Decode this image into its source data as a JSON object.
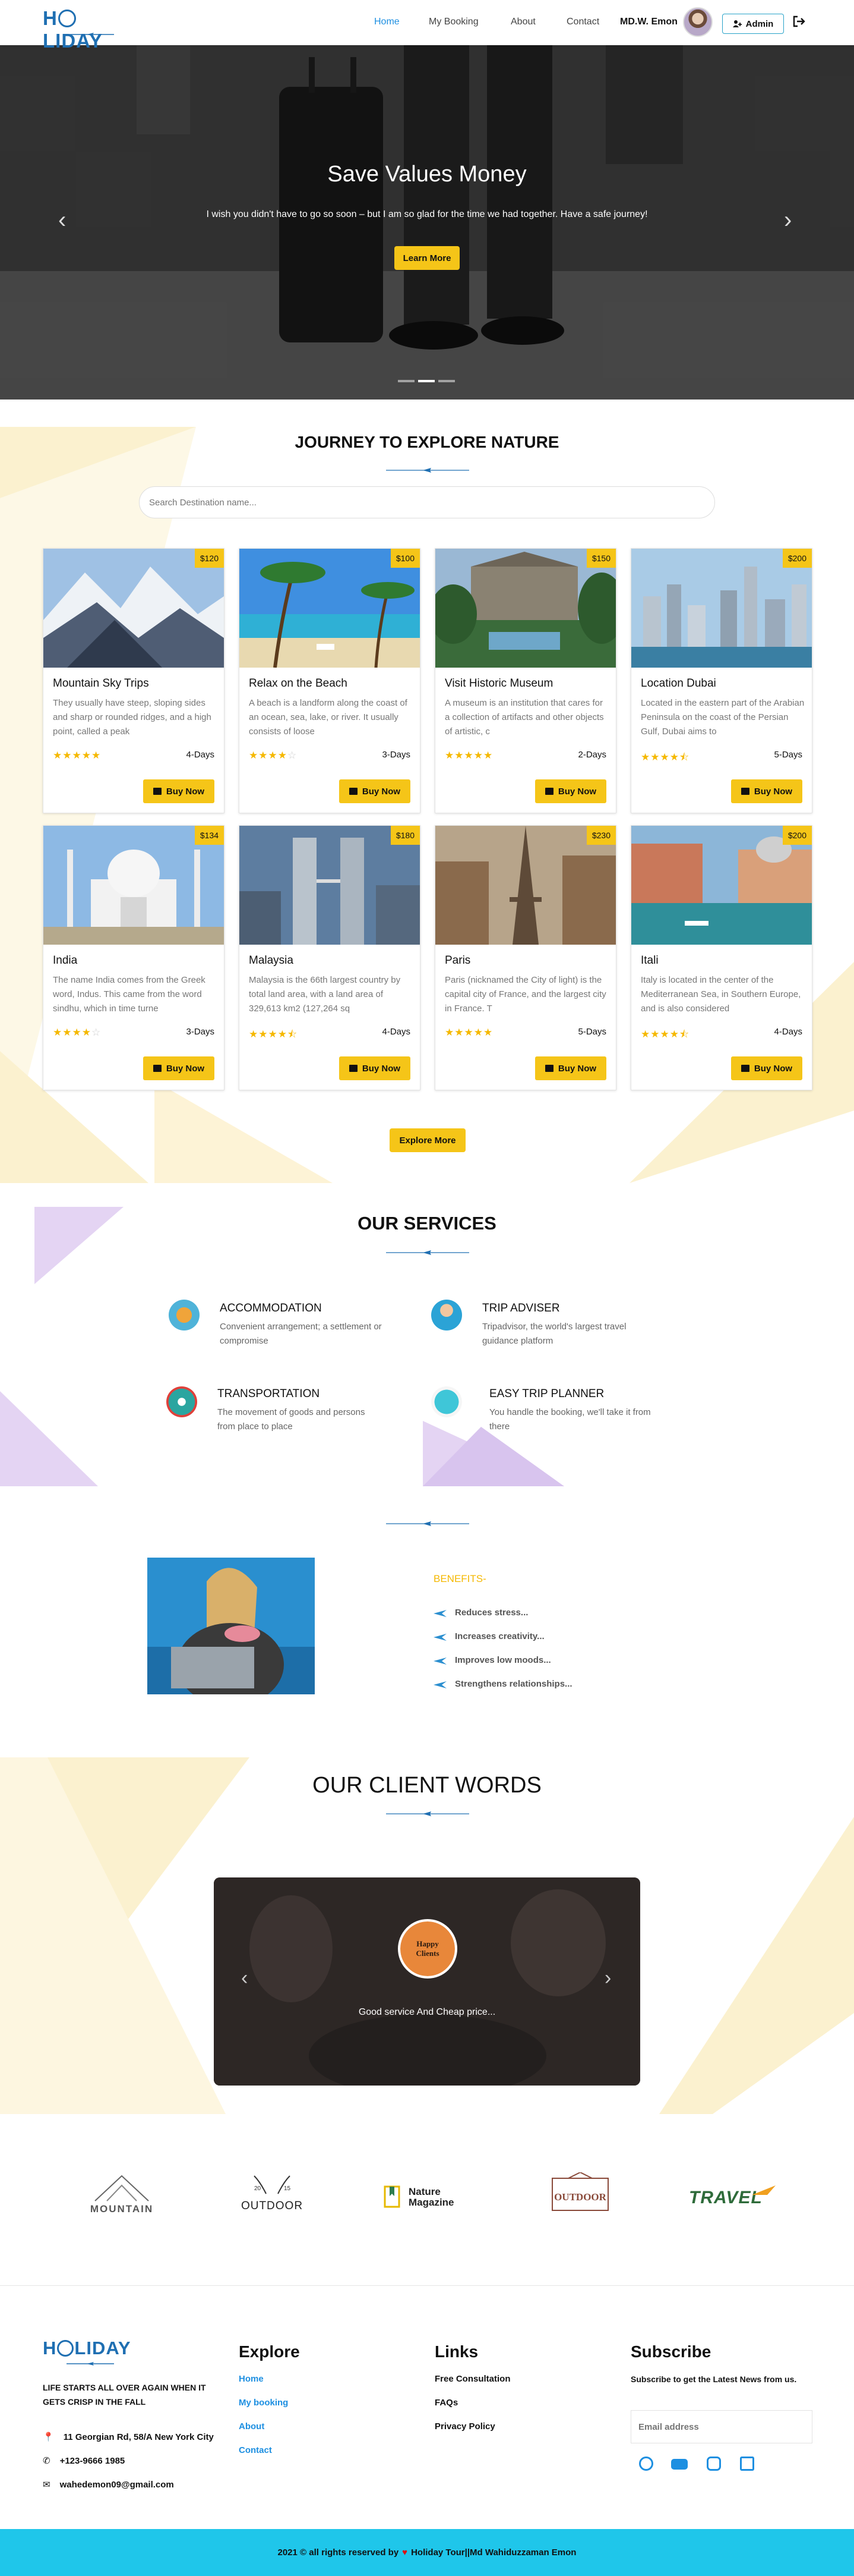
{
  "nav": {
    "logo": "HOLIDAY",
    "links": [
      "Home",
      "My Booking",
      "About",
      "Contact"
    ],
    "user_name": "MD.W. Emon",
    "admin_label": "Admin"
  },
  "hero": {
    "title": "Save Values Money",
    "subtitle": "I wish you didn't have to go so soon – but I am so glad for the time we had together. Have a safe journey!",
    "button": "Learn More"
  },
  "journey": {
    "title": "JOURNEY TO EXPLORE NATURE",
    "search_placeholder": "Search Destination name...",
    "buy_label": "Buy Now",
    "explore_more": "Explore More",
    "cards": [
      {
        "title": "Mountain Sky Trips",
        "price": "$120",
        "desc": "They usually have steep, sloping sides and sharp or rounded ridges, and a high point, called a peak",
        "days": "4-Days",
        "rating": 5
      },
      {
        "title": "Relax on the Beach",
        "price": "$100",
        "desc": "A beach is a landform along the coast of an ocean, sea, lake, or river. It usually consists of loose",
        "days": "3-Days",
        "rating": 4
      },
      {
        "title": "Visit Historic Museum",
        "price": "$150",
        "desc": "A museum is an institution that cares for a collection of artifacts and other objects of artistic, c",
        "days": "2-Days",
        "rating": 5
      },
      {
        "title": "Location Dubai",
        "price": "$200",
        "desc": "Located in the eastern part of the Arabian Peninsula on the coast of the Persian Gulf, Dubai aims to",
        "days": "5-Days",
        "rating": 4.5
      },
      {
        "title": "India",
        "price": "$134",
        "desc": "The name India comes from the Greek word, Indus. This came from the word sindhu, which in time turne",
        "days": "3-Days",
        "rating": 4
      },
      {
        "title": "Malaysia",
        "price": "$180",
        "desc": "Malaysia is the 66th largest country by total land area, with a land area of 329,613 km2 (127,264 sq",
        "days": "4-Days",
        "rating": 4.5
      },
      {
        "title": "Paris",
        "price": "$230",
        "desc": "Paris (nicknamed the City of light) is the capital city of France, and the largest city in France. T",
        "days": "5-Days",
        "rating": 5
      },
      {
        "title": "Itali",
        "price": "$200",
        "desc": "Italy is located in the center of the Mediterranean Sea, in Southern Europe, and is also considered",
        "days": "4-Days",
        "rating": 4.5
      }
    ]
  },
  "services": {
    "title": "OUR SERVICES",
    "items": [
      {
        "title": "ACCOMMODATION",
        "desc": "Convenient arrangement; a settlement or compromise"
      },
      {
        "title": "TRIP ADVISER",
        "desc": "Tripadvisor, the world's largest travel guidance platform"
      },
      {
        "title": "TRANSPORTATION",
        "desc": "The movement of goods and persons from place to place"
      },
      {
        "title": "EASY TRIP PLANNER",
        "desc": "You handle the booking, we'll take it from there"
      }
    ]
  },
  "benefits": {
    "title": "BENEFITS-",
    "items": [
      "Reduces stress...",
      "Increases creativity...",
      "Improves low moods...",
      "Strengthens relationships..."
    ]
  },
  "clients": {
    "title": "OUR CLIENT WORDS",
    "quote": "Good service And Cheap price..."
  },
  "brands": [
    "MOUNTAIN",
    "OUTDOOR",
    "Nature Magazine",
    "OUTDOOR",
    "TRAVEL"
  ],
  "footer": {
    "logo": "HOLIDAY",
    "tagline": "LIFE STARTS ALL OVER AGAIN WHEN IT GETS CRISP IN THE FALL",
    "address": "11 Georgian Rd, 58/A New York City",
    "phone": "+123-9666 1985",
    "email": "wahedemon09@gmail.com",
    "explore_title": "Explore",
    "explore_links": [
      "Home",
      "My booking",
      "About",
      "Contact"
    ],
    "links_title": "Links",
    "links": [
      "Free Consultation",
      "FAQs",
      "Privacy Policy"
    ],
    "subscribe_title": "Subscribe",
    "subscribe_text": "Subscribe to get the Latest News from us.",
    "email_placeholder": "Email address",
    "copyright_pre": "2021 © all rights reserved by",
    "copyright_post": "Holiday Tour||Md Wahiduzzaman Emon"
  },
  "colors": {
    "accent": "#f5c518",
    "brand_blue": "#1f6fb2",
    "link_blue": "#1d8fe1",
    "cyan": "#1fc6ea"
  }
}
